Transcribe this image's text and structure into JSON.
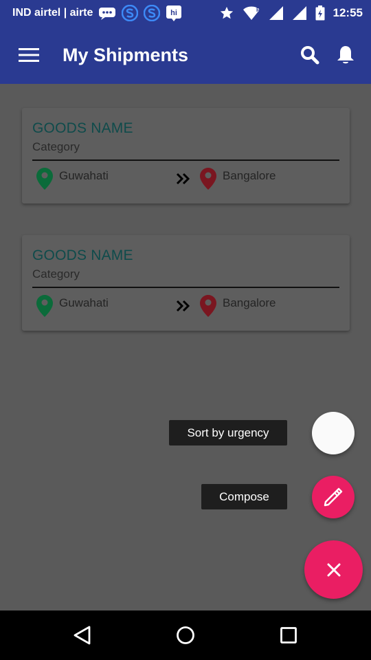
{
  "status_bar": {
    "carrier": "IND airtel | airte",
    "network_type": "R",
    "time": "12:55",
    "icons": [
      "chat-icon",
      "app-s-icon",
      "app-s-icon",
      "hike-icon",
      "star-icon",
      "wifi-icon",
      "signal-icon",
      "signal-icon",
      "battery-icon"
    ]
  },
  "app_bar": {
    "title": "My Shipments",
    "icons": [
      "menu-icon",
      "search-icon",
      "bell-icon"
    ]
  },
  "shipments": [
    {
      "goods_name": "GOODS NAME",
      "category": "Category",
      "from": "Guwahati",
      "to": "Bangalore"
    },
    {
      "goods_name": "GOODS NAME",
      "category": "Category",
      "from": "Guwahati",
      "to": "Bangalore"
    }
  ],
  "fab_menu": {
    "sort_label": "Sort by urgency",
    "compose_label": "Compose",
    "icons": [
      "pencil-icon",
      "close-icon"
    ]
  },
  "colors": {
    "app_bar": "#2a3a91",
    "background": "#5a5a5a",
    "accent": "#ea1e63",
    "title_text": "#0f4b4b",
    "from_pin": "#0b6b3a",
    "to_pin": "#7a1620"
  },
  "nav_bar": {
    "icons": [
      "back-icon",
      "home-icon",
      "recents-icon"
    ]
  }
}
